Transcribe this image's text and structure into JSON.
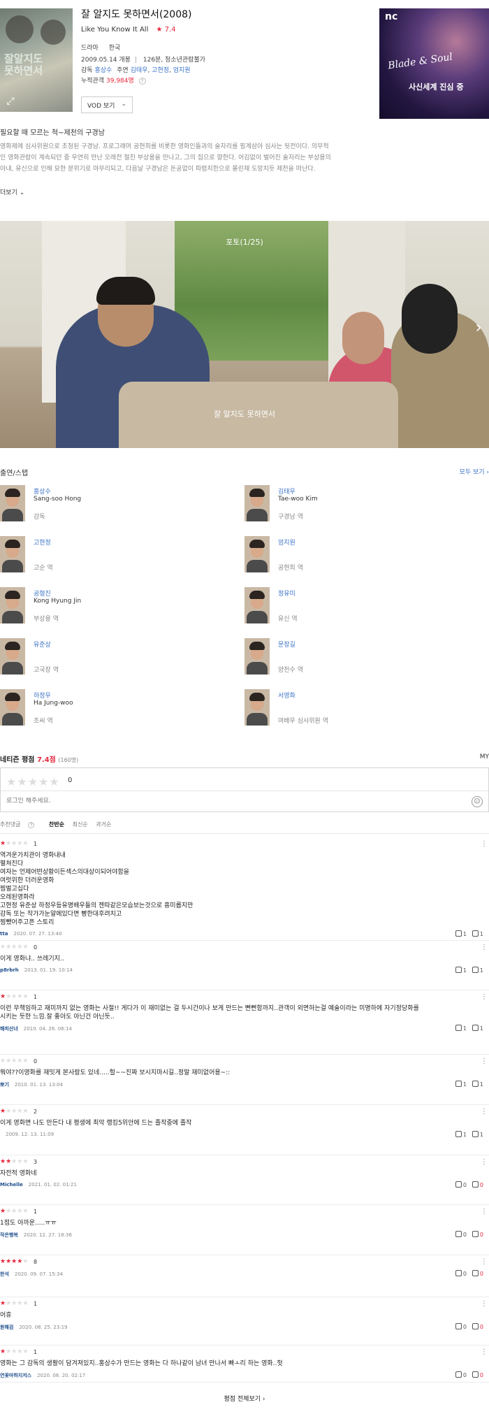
{
  "movie": {
    "title": "잘 알지도 못하면서(2008)",
    "english_title": "Like You Know It All",
    "rating_star": "★ 7.4",
    "genre": "드라마",
    "country": "한국",
    "release": "2009.05.14 개봉",
    "runtime_grade": "126분, 청소년관람불가",
    "director_label": "감독",
    "director": "홍상수",
    "cast_label": "주연",
    "leads": [
      "김태우",
      "고현정",
      "엄지원"
    ],
    "audience_label": "누적관객",
    "audience": "39,984명",
    "vod_label": "VOD 보기"
  },
  "poster": {
    "overlay_title": "잘알지도 못하면서"
  },
  "ad": {
    "brand": "nc",
    "game": "Blade & Soul",
    "copy": "사신세계 진심 중"
  },
  "synopsis": {
    "title": "필요할 때 모르는 척~제천의 구경남",
    "lines": [
      "영화제에 심사위원으로 초청된 구경남. 프로그래머 공현희를 비롯한 영화인들과의 술자리를 핑계삼아 심사는 뒷전이다. 의무적",
      "인 영화관람이 계속되던 중 우연히 만난 오래전 절친 부상용을 만나고, 그의 집으로 향한다. 어김없이 벌어진 술자리는 부상용의",
      "아내, 유신으로 인해 묘한 분위기로 마무리되고, 다음날 구경남은 돈공없이 파렴치한으로 몰린채 도망치듯 제천을 떠난다."
    ],
    "more": "더보기"
  },
  "photo": {
    "counter": "포토(1/25)",
    "caption": "잘 알지도 못하면서"
  },
  "cast_section": {
    "title": "출연/스탭",
    "see_all": "모두 보기",
    "people": [
      {
        "name": "홍상수",
        "en": "Sang-soo Hong",
        "role": "감독"
      },
      {
        "name": "김태우",
        "en": "Tae-woo Kim",
        "role": "구경남 역"
      },
      {
        "name": "고현정",
        "en": "",
        "role": "고순 역"
      },
      {
        "name": "엄지원",
        "en": "",
        "role": "공현희 역"
      },
      {
        "name": "공형진",
        "en": "Kong Hyung Jin",
        "role": "부상용 역"
      },
      {
        "name": "정유미",
        "en": "",
        "role": "유신 역"
      },
      {
        "name": "유준상",
        "en": "",
        "role": "고국장 역"
      },
      {
        "name": "문창길",
        "en": "",
        "role": "양천수 역"
      },
      {
        "name": "하정우",
        "en": "Ha Jung-woo",
        "role": "조씨 역"
      },
      {
        "name": "서영화",
        "en": "",
        "role": "여배우 심사위원 역"
      }
    ]
  },
  "reviews_section": {
    "title": "네티즌 평점",
    "score": "7.4점",
    "count": "(160명)",
    "my": "MY",
    "my_rating": "0",
    "login_placeholder": "로그인 해주세요.",
    "sort": {
      "recommended": "추천댓글",
      "pro_con": "찬반순",
      "latest": "최신순",
      "past": "과거순"
    },
    "all_reviews": "평점 전체보기",
    "items": [
      {
        "stars": 1,
        "score": "1",
        "text": "역겨운가치관이 영화내내\n펼쳐진다\n여자는 언제어떤상황이든섹스의대상이되어야함을\n여럿위한 더러운영화\n찜벌고십다\n오레된영화라\n고현정 유준상 하정우등유명배우들의 젠따같은모습보는것으로 흥미롭지만\n감독 또는 작가가눈알에있다면 빵한대후려치고\n찜뺐어주고픈 스토리",
        "author": "tta",
        "date": "2020. 07. 27. 13:40",
        "up": "1",
        "down": "1"
      },
      {
        "stars": 0,
        "score": "0",
        "text": "이게 영화냐.. 쓰레기지..",
        "author": "p8rbrh",
        "date": "2013. 01. 19. 10:14",
        "up": "1",
        "down": "1"
      },
      {
        "stars": 1,
        "score": "1",
        "text": "이런 무책임하고 재미까지 없는 영화는 사절!! 게다가 이 재미없는 걸 두시간이나 보게 만드는 뻔뻔함까지..관객이 외면하는걸 예술이라는 미명하에 자기정당화를\n시키는 듯한 느낌.잘 좋아도 아닌건 아닌듯..",
        "author": "해피산녀",
        "date": "2010. 04. 26. 06:14",
        "up": "1",
        "down": "1"
      },
      {
        "stars": 0,
        "score": "0",
        "text": "뭐야??이영화를 재밋게 본사람도 있네.....헐~~진짜 보시지마시길..정말 재미없어용~::",
        "author": "뽀기",
        "date": "2010. 01. 13. 13:04",
        "up": "1",
        "down": "1"
      },
      {
        "stars": 1,
        "score": "2",
        "text": "이게 영화면 나도 만든다  내 평생에 최악 랭킹5위안에 드는 졸작중에 졸작",
        "author": "",
        "date": "2009. 12. 13. 11:09",
        "up": "1",
        "down": "1"
      },
      {
        "stars": 2,
        "score": "3",
        "text": "자전적 영화네",
        "author": "Michelle",
        "date": "2021. 01. 02. 01:21",
        "up": "0",
        "down": "0"
      },
      {
        "stars": 1,
        "score": "1",
        "text": "1점도 아까운.....ㅠㅠ",
        "author": "작은행복",
        "date": "2020. 12. 27. 18:36",
        "up": "0",
        "down": "0"
      },
      {
        "stars": 4,
        "score": "8",
        "text": "",
        "author": "한석",
        "date": "2020. 09. 07. 15:34",
        "up": "0",
        "down": "0"
      },
      {
        "stars": 1,
        "score": "1",
        "text": "어휴",
        "author": "원해검",
        "date": "2020. 08. 25. 23:19",
        "up": "0",
        "down": "0"
      },
      {
        "stars": 1,
        "score": "1",
        "text": "영화는 그 감독의 생활이 담겨져있지..홍상수가 만드는 영화는 다 하나같이 남녀 만나서 빠ㅗ리 하는 영화..헛",
        "author": "연꽃마하지저스",
        "date": "2020. 08. 20. 02:17",
        "up": "0",
        "down": "0"
      }
    ]
  },
  "colors": {
    "accent_red": "#e6283d",
    "link_blue": "#3a72c7"
  },
  "icons": [
    "expand-icon",
    "chevron-down-icon",
    "chevron-right-icon",
    "star-icon",
    "emoji-icon",
    "kebab-icon",
    "thumb-up-icon",
    "thumb-down-icon",
    "question-icon"
  ]
}
